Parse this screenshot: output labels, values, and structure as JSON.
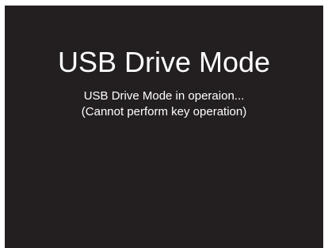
{
  "screen": {
    "background": "#231f20",
    "text_color": "#ffffff",
    "title": "USB Drive Mode",
    "message_line1": "USB Drive Mode in operaion...",
    "message_line2": "(Cannot perform key operation)"
  }
}
